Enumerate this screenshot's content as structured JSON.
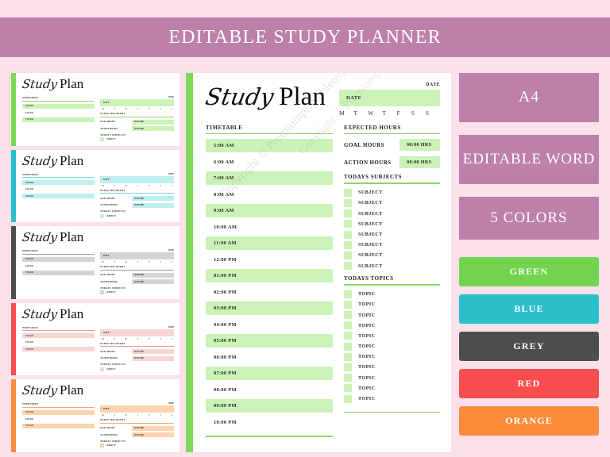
{
  "header": {
    "title": "EDITABLE STUDY PLANNER"
  },
  "theme": {
    "background": "#fce0ec",
    "header_bg": "#bc80ab",
    "badge_bg": "#bc80ab",
    "page_bg": "#ffffff"
  },
  "planner": {
    "title_script": "Study",
    "title_plain": "Plan",
    "date_label": "DATE",
    "date_box_label": "DATE",
    "days": [
      "M",
      "T",
      "W",
      "T",
      "F",
      "S",
      "S"
    ],
    "timetable_heading": "TIMETABLE",
    "timetable": [
      "5:00 AM",
      "6:00 AM",
      "7:00 AM",
      "8:00 AM",
      "9:00 AM",
      "10:00 AM",
      "11:00 AM",
      "12:00 PM",
      "01:00 PM",
      "02:00 PM",
      "03:00 PM",
      "04:00 PM",
      "05:00 PM",
      "06:00 PM",
      "07:00 PM",
      "08:00 PM",
      "09:00 PM",
      "10:00 PM"
    ],
    "expected_hours_heading": "EXPECTED HOURS",
    "goal_hours_label": "GOAL HOURS",
    "goal_hours_value": "00:00 HRS",
    "action_hours_label": "ACTION HOURS",
    "action_hours_value": "00:00 HRS",
    "subjects_heading": "TODAYS SUBJECTS",
    "subjects": [
      "SUBJECT",
      "SUBJECT",
      "SUBJECT",
      "SUBJECT",
      "SUBJECT",
      "SUBJECT",
      "SUBJECT",
      "SUBJECT"
    ],
    "topics_heading": "TODAYS TOPICS",
    "topics": [
      "TOPIC",
      "TOPIC",
      "TOPIC",
      "TOPIC",
      "TOPIC",
      "TOPIC",
      "TOPIC",
      "TOPIC",
      "TOPIC",
      "TOPIC",
      "TOPIC"
    ],
    "watermark": "Copyright © Premiumprintabletemplates.com"
  },
  "thumbnails": [
    {
      "name": "green",
      "bar": "#7ed957",
      "fill": "#ccf3b7",
      "rule": "#8ed36b"
    },
    {
      "name": "blue",
      "bar": "#2bbfcc",
      "fill": "#bfefef",
      "rule": "#6fd3da"
    },
    {
      "name": "grey",
      "bar": "#4d4d4d",
      "fill": "#d4d4d4",
      "rule": "#9a9a9a"
    },
    {
      "name": "red",
      "bar": "#fa4d50",
      "fill": "#f7d5d3",
      "rule": "#f09a98"
    },
    {
      "name": "orange",
      "bar": "#fb8c3c",
      "fill": "#fbd3ae",
      "rule": "#f5aa6d"
    }
  ],
  "rail": {
    "badges": [
      {
        "label": "A4"
      },
      {
        "label": "EDITABLE WORD"
      },
      {
        "label": "5 COLORS"
      }
    ],
    "swatches": [
      {
        "label": "GREEN",
        "color": "#72d44f"
      },
      {
        "label": "BLUE",
        "color": "#2bbfcc"
      },
      {
        "label": "GREY",
        "color": "#4d4d4d"
      },
      {
        "label": "RED",
        "color": "#fa4d50"
      },
      {
        "label": "ORANGE",
        "color": "#fb8c3c"
      }
    ]
  }
}
